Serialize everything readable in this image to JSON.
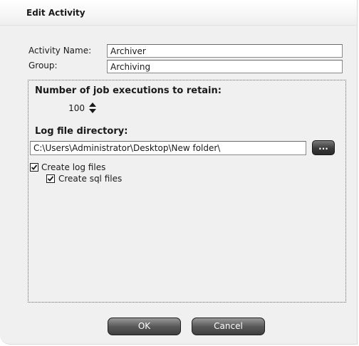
{
  "dialog": {
    "title": "Edit Activity"
  },
  "fields": {
    "activity_name_label": "Activity Name:",
    "activity_name_value": "Archiver",
    "group_label": "Group:",
    "group_value": "Archiving"
  },
  "retention": {
    "label": "Number of job executions to retain:",
    "value": "100"
  },
  "log": {
    "label": "Log file directory:",
    "path": "C:\\Users\\Administrator\\Desktop\\New folder\\",
    "browse_label": "...",
    "create_log_label": "Create log files",
    "create_log_checked": true,
    "create_sql_label": "Create sql files",
    "create_sql_checked": true
  },
  "buttons": {
    "ok_label": "OK",
    "cancel_label": "Cancel"
  },
  "icons": {
    "spin": "up-down-arrows-icon",
    "checkmark": "check-icon"
  }
}
